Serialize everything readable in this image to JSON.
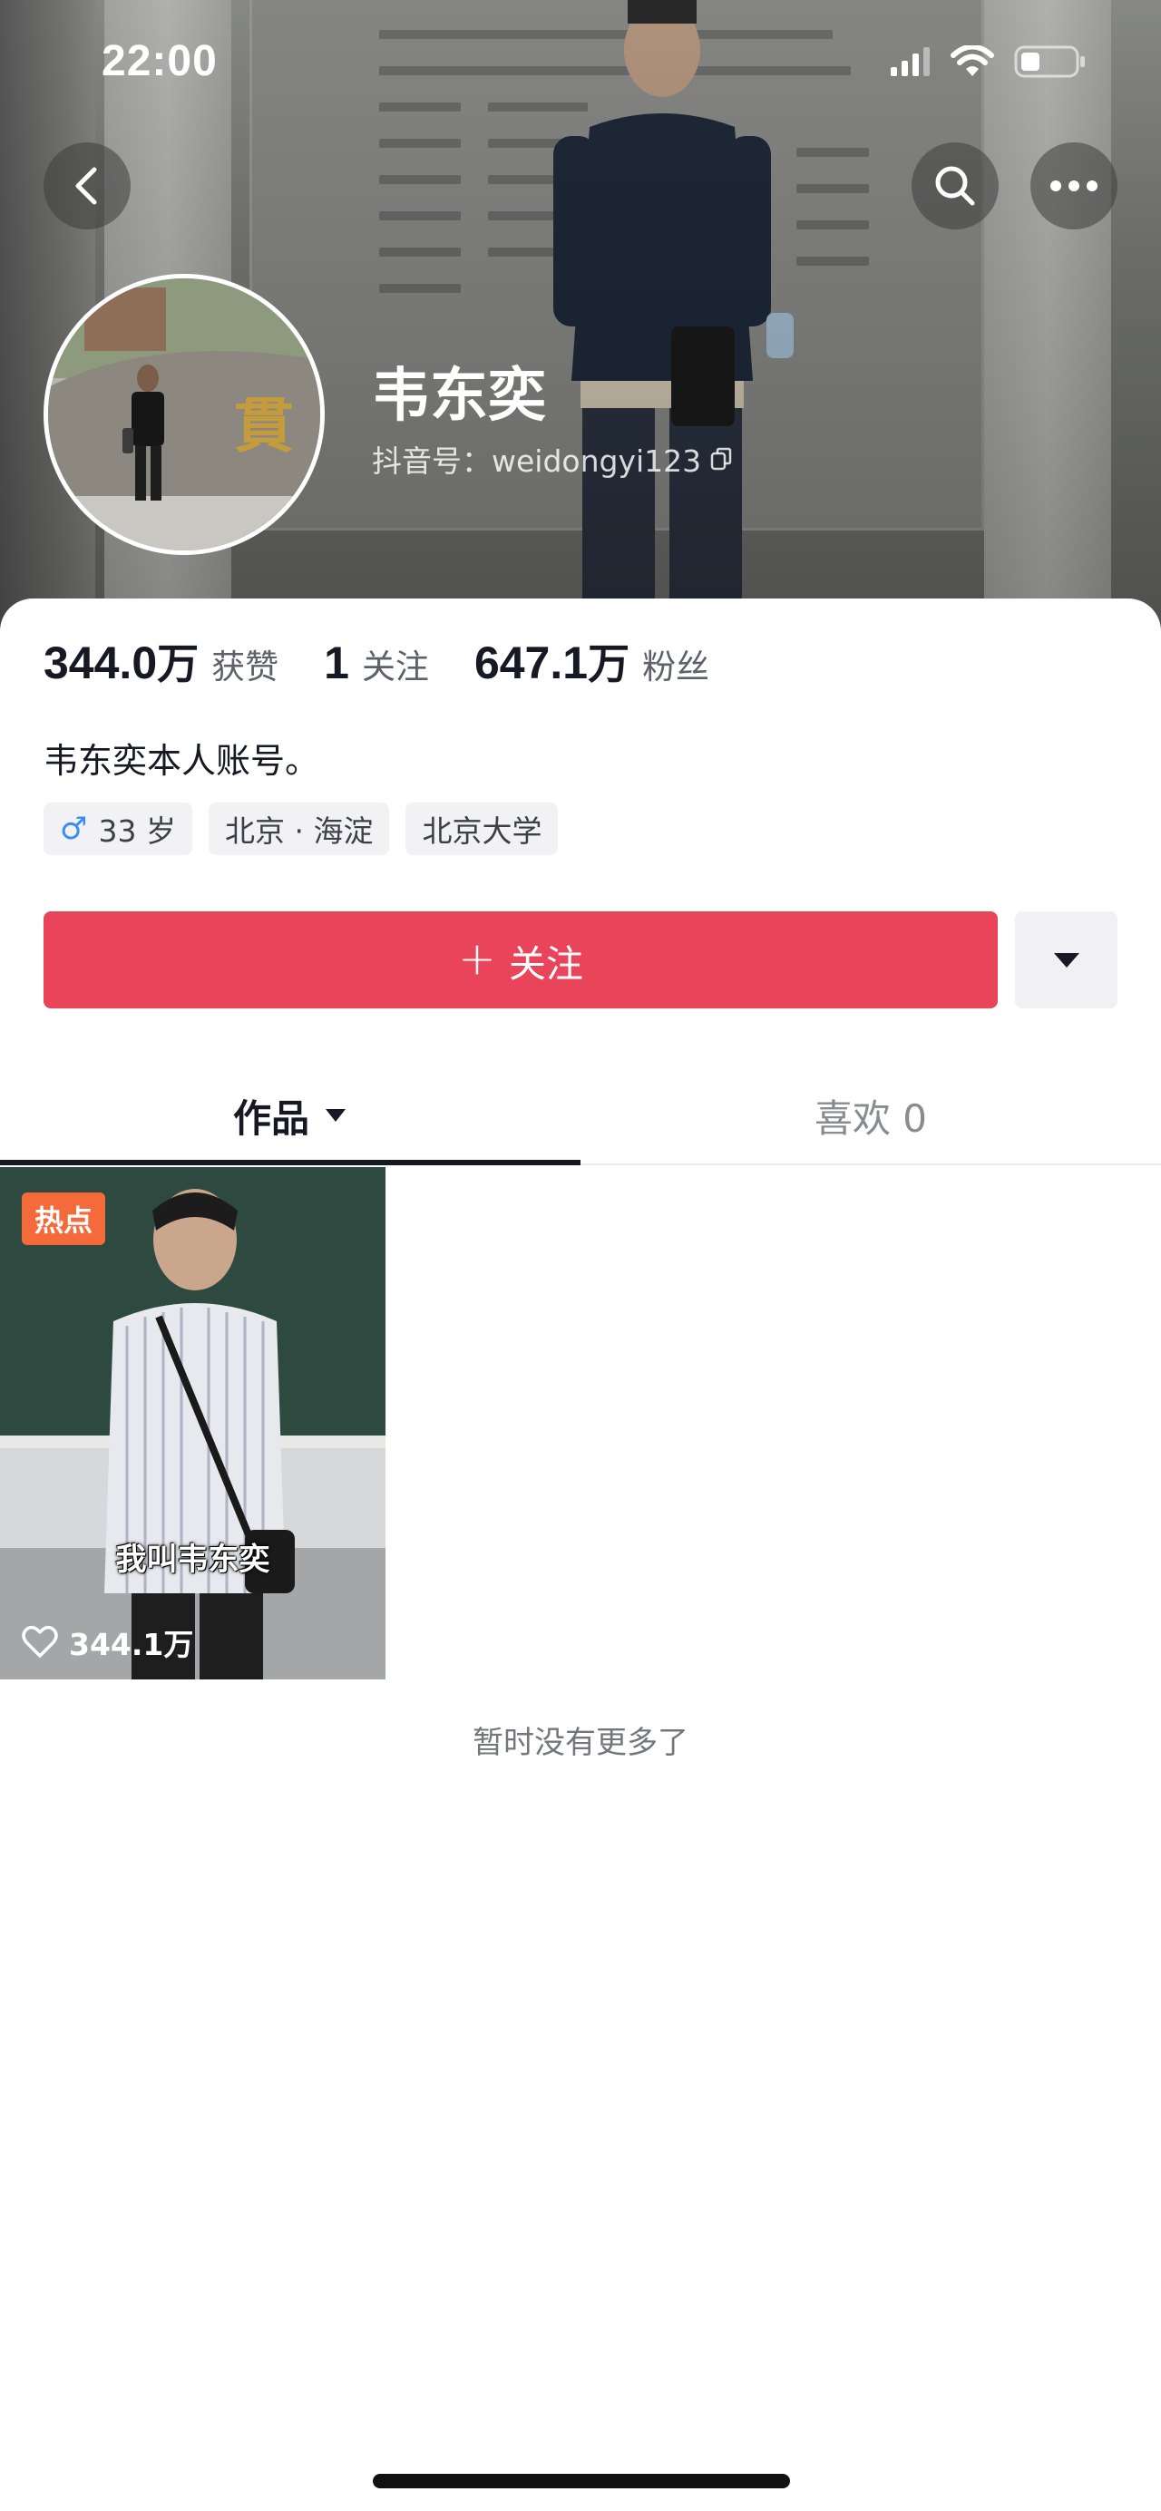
{
  "status_bar": {
    "time": "22:00"
  },
  "profile": {
    "name": "韦东奕",
    "douyin_id": "抖音号：weidongyi123",
    "bio": "韦东奕本人账号。"
  },
  "stats": [
    {
      "number": "344.0",
      "unit": "万",
      "label": "获赞"
    },
    {
      "number": "1",
      "unit": "",
      "label": "关注"
    },
    {
      "number": "647.1",
      "unit": "万",
      "label": "粉丝"
    }
  ],
  "tags": [
    {
      "icon": "male-icon",
      "symbol": "♂",
      "label": "33 岁"
    },
    {
      "label": "北京 · 海淀"
    },
    {
      "label": "北京大学"
    }
  ],
  "actions": {
    "follow_label": "关注",
    "follow_plus": "+"
  },
  "tabs": [
    {
      "label": "作品",
      "active": true
    },
    {
      "label": "喜欢 0",
      "active": false
    }
  ],
  "videos": [
    {
      "badge": "热点",
      "caption": "我叫韦东奕",
      "likes": "344.1万"
    }
  ],
  "footer": {
    "no_more": "暂时没有更多了"
  },
  "colors": {
    "accent": "#ea445a",
    "hot_badge": "#f56a3a",
    "gender_icon": "#3b8cf4"
  }
}
